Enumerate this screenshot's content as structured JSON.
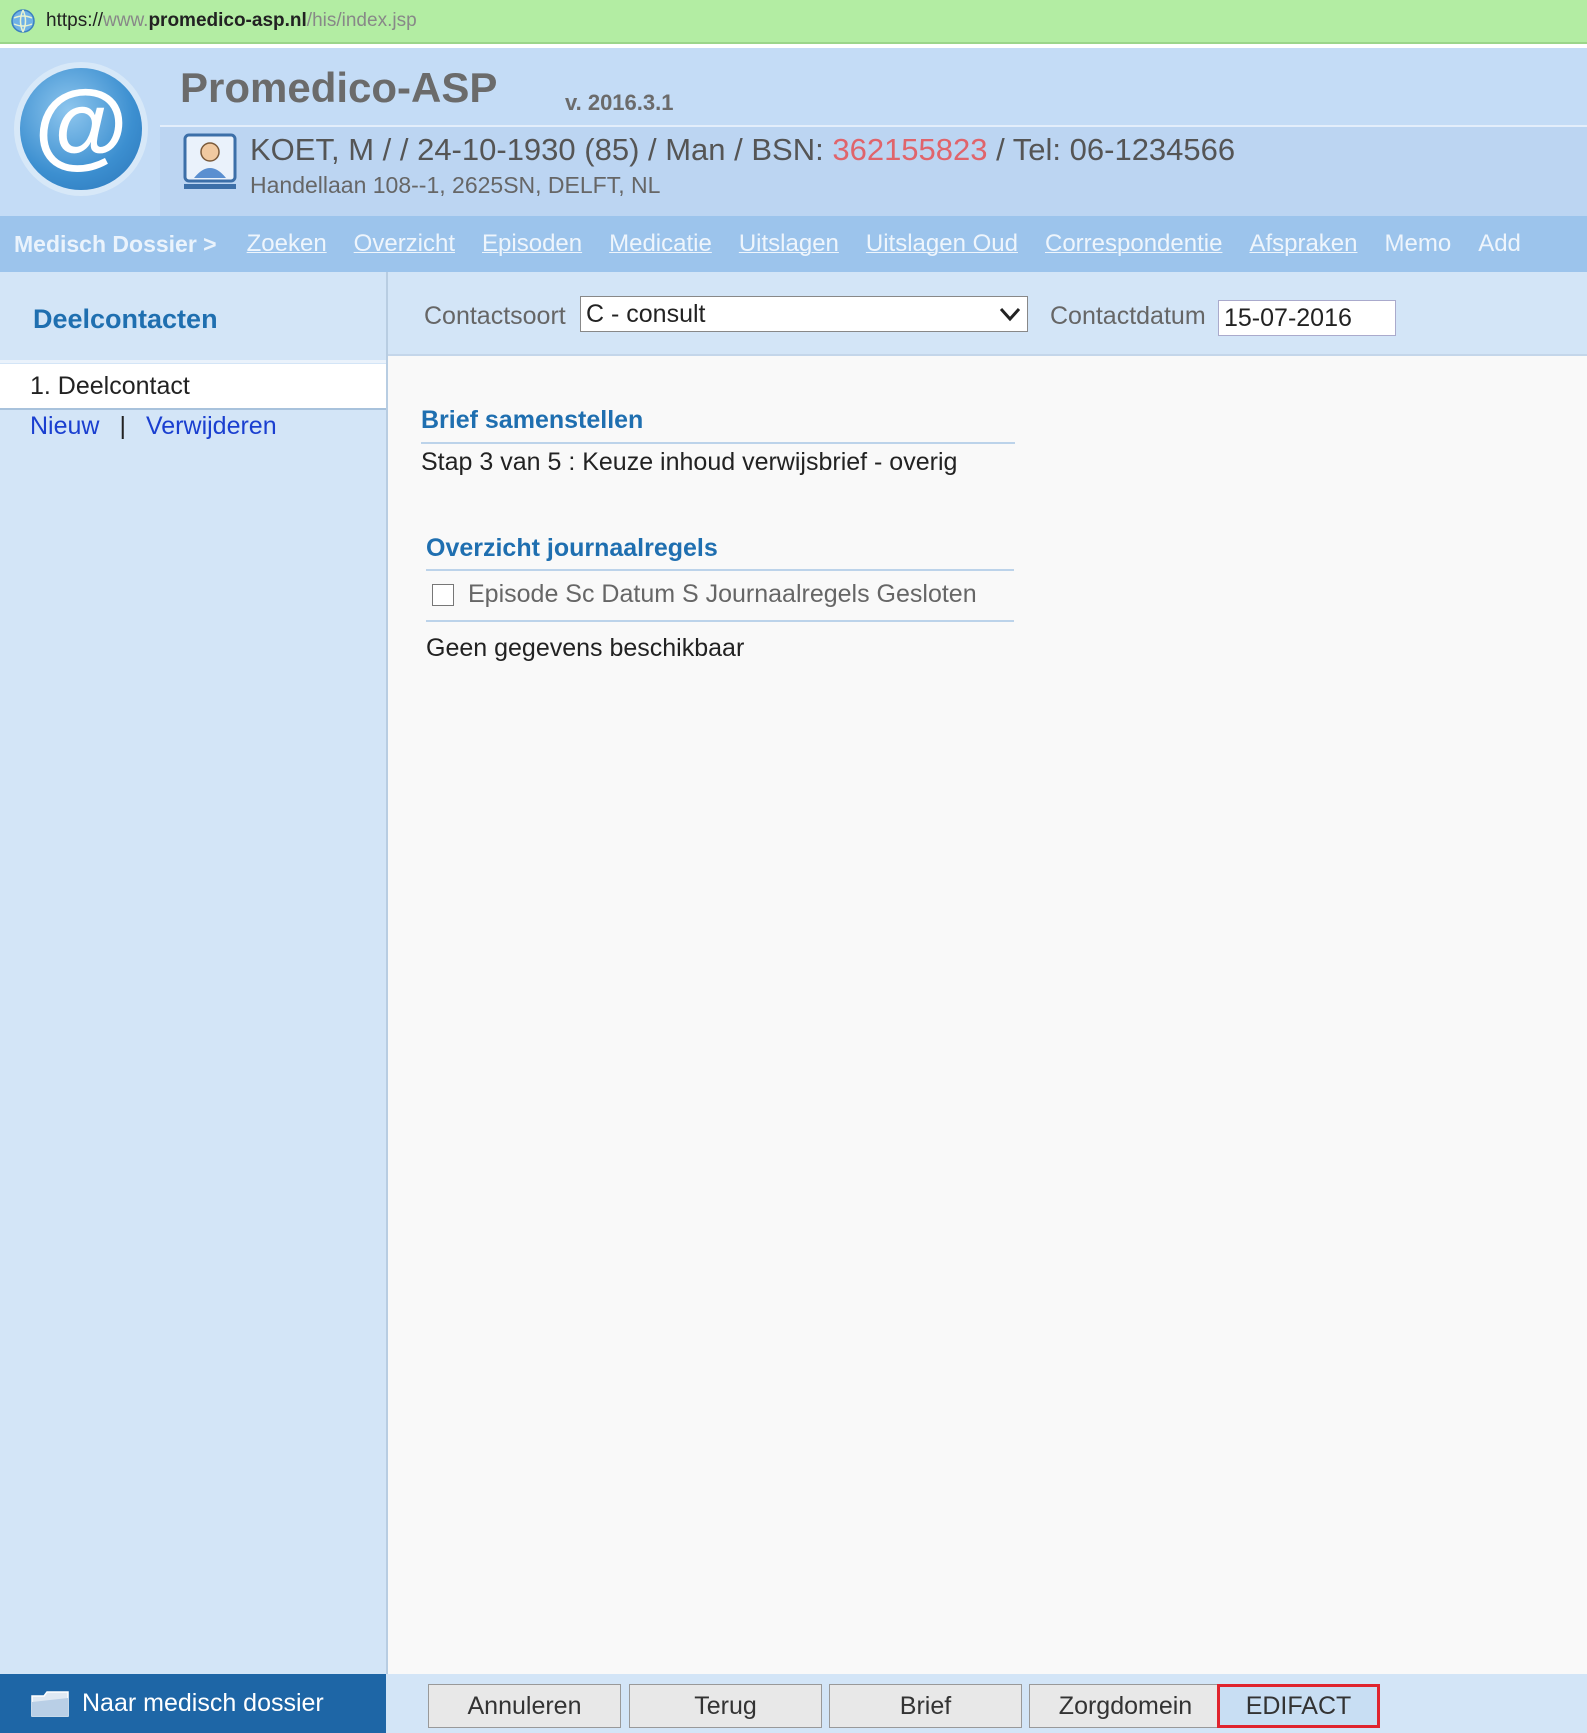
{
  "url_bar": {
    "scheme": "https://",
    "sub": "www.",
    "domain": "promedico-asp.nl",
    "path": "/his/index.jsp"
  },
  "header": {
    "app_title": "Promedico-ASP",
    "version": "v. 2016.3.1",
    "patient": {
      "info_prefix": "KOET, M / / 24-10-1930 (85) / Man / BSN: ",
      "bsn": "362155823",
      "info_suffix": " / Tel: 06-1234566",
      "address": "Handellaan 108--1, 2625SN, DELFT, NL"
    }
  },
  "nav": {
    "crumb": "Medisch Dossier >",
    "items": [
      "Zoeken",
      "Overzicht",
      "Episoden",
      "Medicatie",
      "Uitslagen",
      "Uitslagen Oud",
      "Correspondentie",
      "Afspraken",
      "Memo",
      "Add"
    ]
  },
  "sidebar": {
    "title": "Deelcontacten",
    "item": "1. Deelcontact",
    "new_link": "Nieuw",
    "separator": "|",
    "delete_link": "Verwijderen"
  },
  "toolbar": {
    "contactsoort_label": "Contactsoort",
    "contactsoort_value": "C - consult",
    "contactdatum_label": "Contactdatum",
    "contactdatum_value": "15-07-2016"
  },
  "letter": {
    "title": "Brief samenstellen",
    "step": "Stap 3 van 5 : Keuze inhoud verwijsbrief - overig"
  },
  "journal": {
    "title": "Overzicht journaalregels",
    "columns": "Episode Sc Datum S Journaalregels Gesloten",
    "empty": "Geen gegevens beschikbaar"
  },
  "footer": {
    "back_to_dossier": "Naar medisch dossier",
    "buttons": {
      "cancel": "Annuleren",
      "back": "Terug",
      "letter": "Brief",
      "zorgdomein": "Zorgdomein",
      "edifact": "EDIFACT"
    }
  },
  "colors": {
    "accent": "#1f6fb0",
    "bsn": "#e0646b",
    "highlight_border": "#e0242e",
    "url_bar_bg": "#b3eda3"
  }
}
